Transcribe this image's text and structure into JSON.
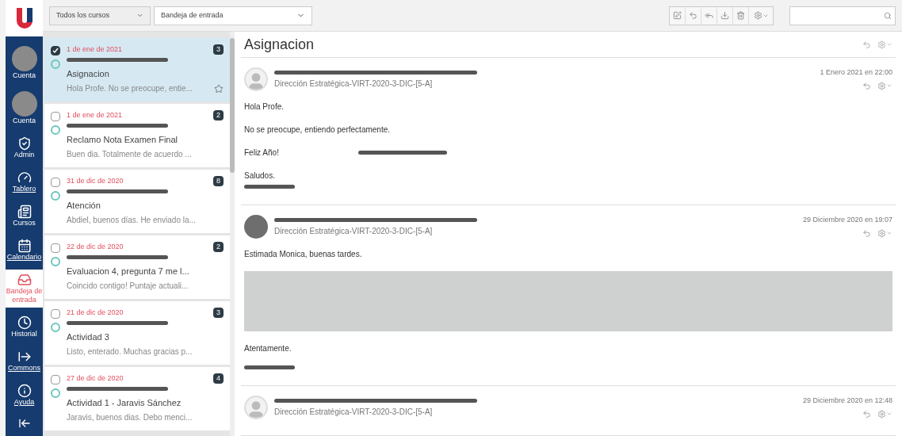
{
  "nav": {
    "items": [
      {
        "kind": "avatar",
        "label": "Cuenta",
        "selected": false,
        "link": false
      },
      {
        "kind": "avatar",
        "label": "Cuenta",
        "selected": false,
        "link": false
      },
      {
        "kind": "admin",
        "label": "Admin",
        "selected": false,
        "link": false
      },
      {
        "kind": "dashboard",
        "label": "Tablero",
        "selected": false,
        "link": true
      },
      {
        "kind": "courses",
        "label": "Cursos",
        "selected": false,
        "link": false
      },
      {
        "kind": "calendar",
        "label": "Calendario",
        "selected": false,
        "link": true
      },
      {
        "kind": "inbox",
        "label": "Bandeja de entrada",
        "selected": true,
        "link": false
      },
      {
        "kind": "history",
        "label": "Historial",
        "selected": false,
        "link": false
      },
      {
        "kind": "commons",
        "label": "Commons",
        "selected": false,
        "link": true
      },
      {
        "kind": "help",
        "label": "Ayuda",
        "selected": false,
        "link": true
      }
    ]
  },
  "toolbar": {
    "course_filter": "Todos los cursos",
    "mailbox_filter": "Bandeja de entrada"
  },
  "conversations": [
    {
      "date": "1 de ene de 2021",
      "count": "3",
      "subject": "Asignacion",
      "preview": "Hola Profe. No se preocupe, entie...",
      "checked": true,
      "selected": true,
      "unread": false
    },
    {
      "date": "1 de ene de 2021",
      "count": "2",
      "subject": "Reclamo Nota Examen Final",
      "preview": "Buen dia. Totalmente de acuerdo ...",
      "checked": false,
      "selected": false,
      "unread": false
    },
    {
      "date": "31 de dic de 2020",
      "count": "8",
      "subject": "Atención",
      "preview": "Abdiel, buenos días. He enviado la...",
      "checked": false,
      "selected": false,
      "unread": false
    },
    {
      "date": "22 de dic de 2020",
      "count": "2",
      "subject": "Evaluacion 4, pregunta 7 me l...",
      "preview": "Coincido contigo! Puntaje actuali...",
      "checked": false,
      "selected": false,
      "unread": false
    },
    {
      "date": "21 de dic de 2020",
      "count": "3",
      "subject": "Actividad 3",
      "preview": "Listo, enterado. Muchas gracias p...",
      "checked": false,
      "selected": false,
      "unread": false
    },
    {
      "date": "27 de dic de 2020",
      "count": "4",
      "subject": "Actividad 1 - Jaravis Sánchez",
      "preview": "Jaravis, buenos dias. Debo menci...",
      "checked": false,
      "selected": false,
      "unread": false
    }
  ],
  "detail": {
    "title": "Asignacion",
    "messages": [
      {
        "kind": "silhouette",
        "date": "1 Enero 2021 en 22:00",
        "course": "Dirección Estratégica-VIRT-2020-3-DIC-[5-A]",
        "paragraphs": [
          [
            {
              "kind": "text",
              "text": "Hola Profe."
            }
          ],
          [
            {
              "kind": "text",
              "text": "No se preocupe, entiendo perfectamente."
            }
          ],
          [
            {
              "kind": "text_redacted",
              "text": "Feliz Año!"
            }
          ],
          [
            {
              "kind": "text",
              "text": "Saludos."
            },
            {
              "kind": "redacted"
            }
          ]
        ]
      },
      {
        "kind": "plain",
        "date": "29 Diciembre 2020 en 19:07",
        "course": "Dirección Estratégica-VIRT-2020-3-DIC-[5-A]",
        "paragraphs": [
          [
            {
              "kind": "text",
              "text": "Estimada Monica, buenas tardes."
            }
          ],
          [
            {
              "kind": "block"
            }
          ],
          [
            {
              "kind": "text",
              "text": "Atentamente."
            }
          ],
          [
            {
              "kind": "redacted"
            }
          ]
        ]
      },
      {
        "kind": "silhouette",
        "date": "29 Diciembre 2020 en 12:48",
        "course": "Dirección Estratégica-VIRT-2020-3-DIC-[5-A]"
      }
    ]
  }
}
